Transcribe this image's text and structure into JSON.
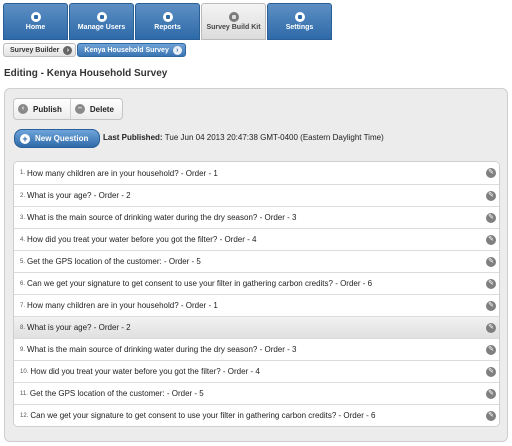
{
  "nav": {
    "tabs": [
      {
        "label": "Home",
        "icon": "home-icon"
      },
      {
        "label": "Manage Users",
        "icon": "user-icon"
      },
      {
        "label": "Reports",
        "icon": "reports-icon"
      },
      {
        "label": "Survey Build Kit",
        "icon": "build-kit-icon",
        "active": true
      },
      {
        "label": "Settings",
        "icon": "wrench-icon"
      }
    ]
  },
  "breadcrumb": [
    "Survey Builder",
    "Kenya Household Survey"
  ],
  "page": {
    "title": "Editing - Kenya Household Survey"
  },
  "toolbar": {
    "publish_label": "Publish",
    "delete_label": "Delete"
  },
  "new_question_label": "New Question",
  "last_published": {
    "label": "Last Published:",
    "value": "Tue Jun 04 2013 20:47:38 GMT-0400 (Eastern Daylight Time)"
  },
  "questions": [
    {
      "num": "1.",
      "text": "How many children are in your household? - Order - 1"
    },
    {
      "num": "2.",
      "text": "What is your age? - Order - 2"
    },
    {
      "num": "3.",
      "text": "What is the main source of drinking water during the dry season? - Order - 3"
    },
    {
      "num": "4.",
      "text": "How did you treat your water before you got the filter? - Order - 4"
    },
    {
      "num": "5.",
      "text": "Get the GPS location of the customer: - Order - 5"
    },
    {
      "num": "6.",
      "text": "Can we get your signature to get consent to use your filter in gathering carbon credits? - Order - 6"
    },
    {
      "num": "7.",
      "text": "How many children are in your household? - Order - 1"
    },
    {
      "num": "8.",
      "text": "What is your age? - Order - 2"
    },
    {
      "num": "9.",
      "text": "What is the main source of drinking water during the dry season? - Order - 3"
    },
    {
      "num": "10.",
      "text": "How did you treat your water before you got the filter? - Order - 4"
    },
    {
      "num": "11.",
      "text": "Get the GPS location of the customer: - Order - 5"
    },
    {
      "num": "12.",
      "text": "Can we get your signature to get consent to use your filter in gathering carbon credits? - Order - 6"
    }
  ],
  "highlighted_row": 8,
  "colors": {
    "nav_blue": "#2e6aa8",
    "panel_bg": "#ececec"
  }
}
